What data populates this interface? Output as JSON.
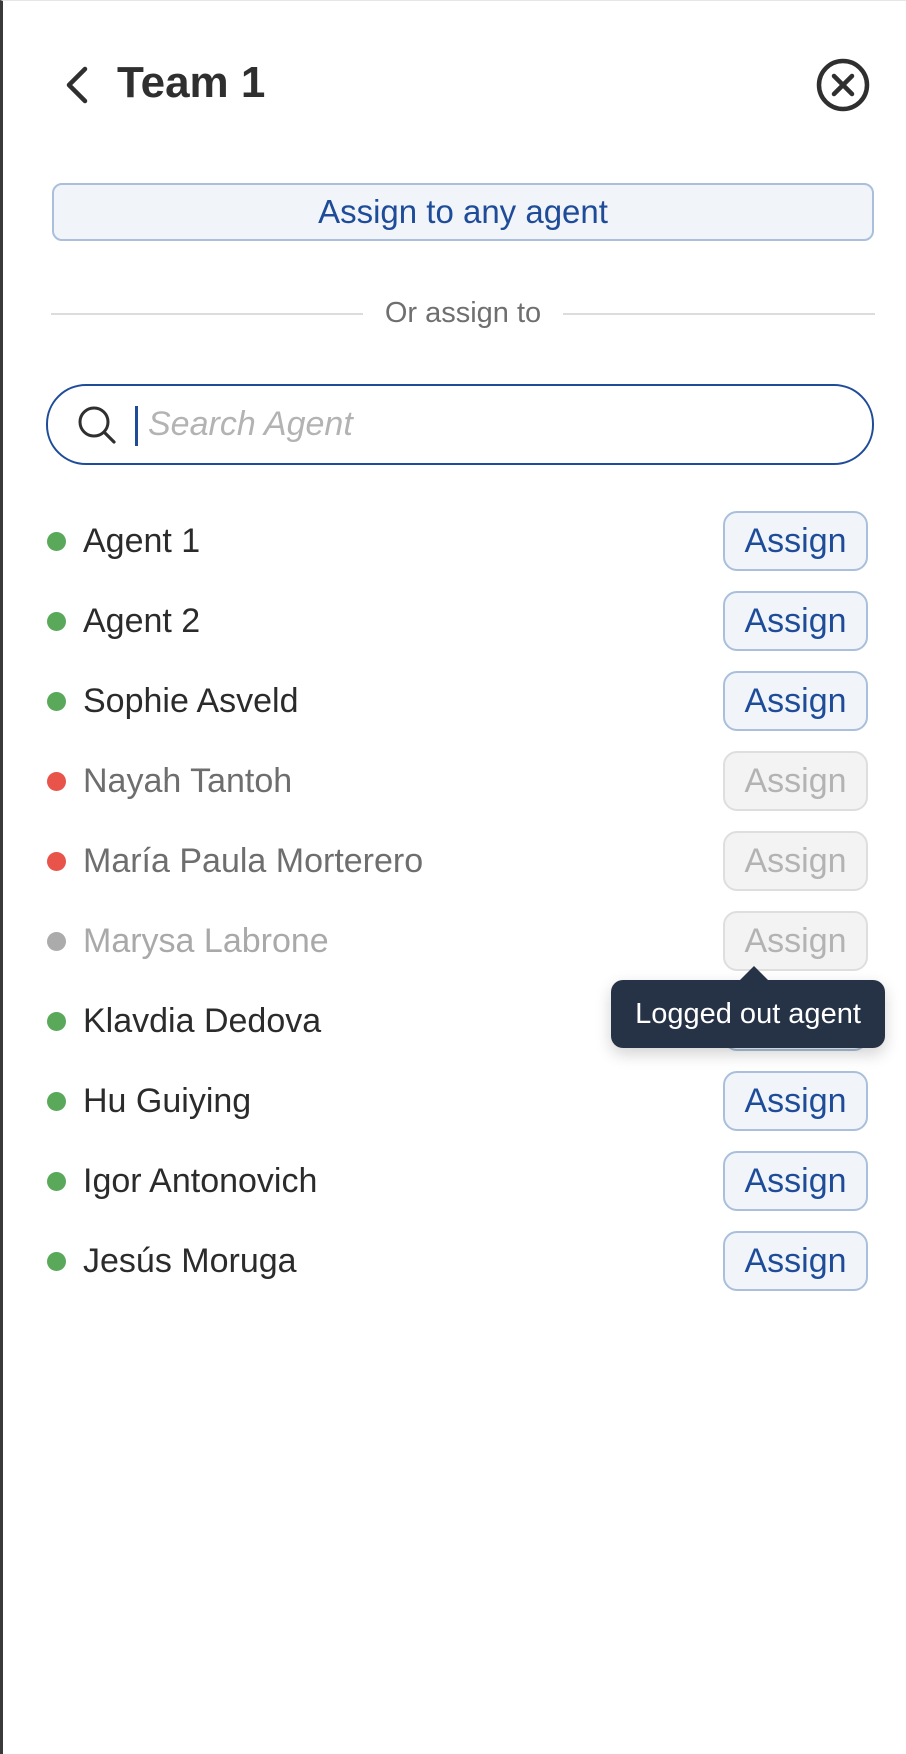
{
  "header": {
    "title": "Team 1",
    "back_icon": "chevron-left-icon",
    "close_icon": "close-circle-icon"
  },
  "assign_any": {
    "label": "Assign to any agent"
  },
  "divider": {
    "label": "Or assign to"
  },
  "search": {
    "placeholder": "Search Agent",
    "value": "",
    "icon": "search-icon"
  },
  "colors": {
    "online": "#5aa95a",
    "busy": "#e8534a",
    "offline": "#ababab",
    "accent": "#1f4c99",
    "tooltip_bg": "#263246"
  },
  "assign_label": "Assign",
  "agents": [
    {
      "name": "Agent 1",
      "status": "online",
      "assign": "Assign",
      "enabled": true
    },
    {
      "name": "Agent 2",
      "status": "online",
      "assign": "Assign",
      "enabled": true
    },
    {
      "name": "Sophie Asveld",
      "status": "online",
      "assign": "Assign",
      "enabled": true
    },
    {
      "name": "Nayah Tantoh",
      "status": "busy",
      "assign": "Assign",
      "enabled": false
    },
    {
      "name": "María Paula Morterero",
      "status": "busy",
      "assign": "Assign",
      "enabled": false
    },
    {
      "name": "Marysa Labrone",
      "status": "offline",
      "assign": "Assign",
      "enabled": false
    },
    {
      "name": "Klavdia Dedova",
      "status": "online",
      "assign": "Assign",
      "enabled": true
    },
    {
      "name": "Hu Guiying",
      "status": "online",
      "assign": "Assign",
      "enabled": true
    },
    {
      "name": "Igor Antonovich",
      "status": "online",
      "assign": "Assign",
      "enabled": true
    },
    {
      "name": "Jesús Moruga",
      "status": "online",
      "assign": "Assign",
      "enabled": true
    }
  ],
  "tooltip": {
    "text": "Logged out agent"
  }
}
